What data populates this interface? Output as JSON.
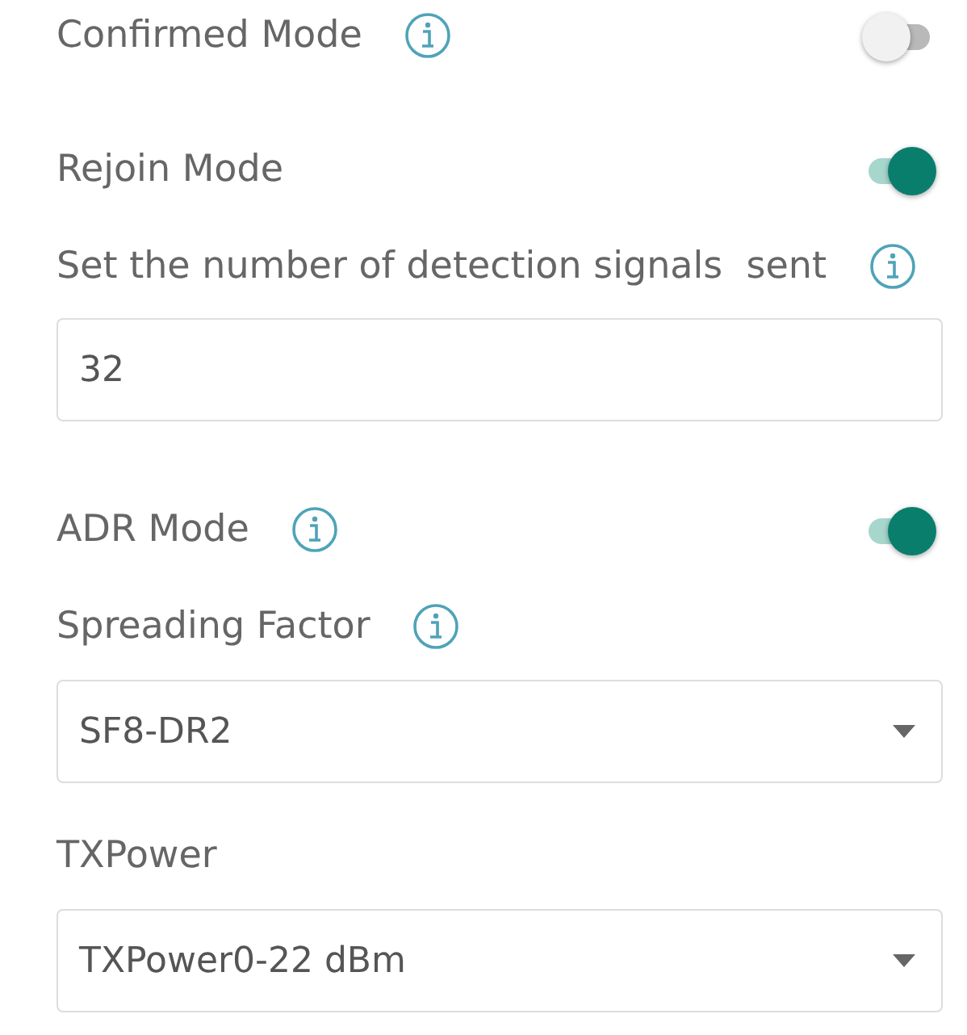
{
  "settings": [
    {
      "kind": "toggle",
      "label": "Confirmed Mode",
      "info": true,
      "on": false
    },
    {
      "kind": "toggle",
      "label": "Rejoin Mode",
      "info": false,
      "on": true
    },
    {
      "kind": "label",
      "label": "Set the number of detection signals  sent",
      "info": true
    },
    {
      "kind": "input",
      "value": "32"
    },
    {
      "kind": "toggle",
      "label": "ADR Mode",
      "info": true,
      "on": true
    },
    {
      "kind": "label",
      "label": "Spreading Factor",
      "info": true
    },
    {
      "kind": "select",
      "value": "SF8-DR2"
    },
    {
      "kind": "label",
      "label": "TXPower",
      "info": false
    },
    {
      "kind": "select",
      "value": "TXPower0-22 dBm"
    }
  ]
}
